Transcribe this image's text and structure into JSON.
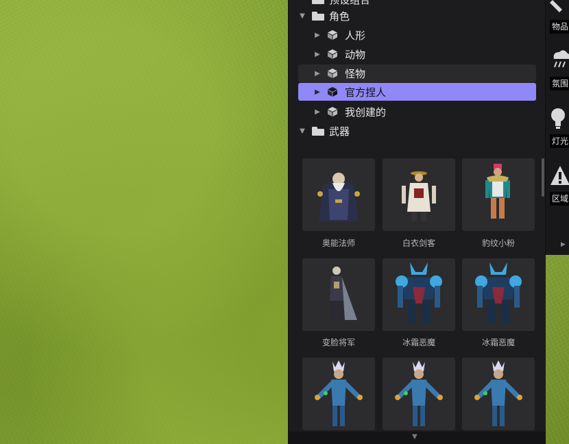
{
  "tree": {
    "top_partial_label": "预设组合",
    "items": [
      {
        "label": "角色",
        "type": "folder",
        "expanded": true,
        "level": 0
      },
      {
        "label": "人形",
        "type": "model",
        "expanded": false,
        "level": 1
      },
      {
        "label": "动物",
        "type": "model",
        "expanded": false,
        "level": 1
      },
      {
        "label": "怪物",
        "type": "model",
        "expanded": false,
        "level": 1,
        "state": "hover"
      },
      {
        "label": "官方捏人",
        "type": "model",
        "expanded": false,
        "level": 1,
        "state": "selected"
      },
      {
        "label": "我创建的",
        "type": "model",
        "expanded": false,
        "level": 1
      },
      {
        "label": "武器",
        "type": "folder",
        "expanded": true,
        "level": 0
      }
    ]
  },
  "grid": {
    "items": [
      {
        "name": "奥能法师",
        "figure": "wizard"
      },
      {
        "name": "白衣剑客",
        "figure": "swordsman"
      },
      {
        "name": "豹纹小粉",
        "figure": "pink"
      },
      {
        "name": "变脸将军",
        "figure": "general"
      },
      {
        "name": "冰霜恶魔",
        "figure": "frost"
      },
      {
        "name": "冰霜恶魔",
        "figure": "frost"
      },
      {
        "name": "",
        "figure": "blue"
      },
      {
        "name": "",
        "figure": "blue"
      },
      {
        "name": "",
        "figure": "blue"
      }
    ]
  },
  "toolbar": {
    "items": [
      {
        "label": "物品",
        "icon": "wrench-icon"
      },
      {
        "label": "氛围",
        "icon": "cloud-rain-icon"
      },
      {
        "label": "灯光",
        "icon": "bulb-icon"
      },
      {
        "label": "区域",
        "icon": "warning-icon"
      }
    ]
  },
  "colors": {
    "panel_bg": "#1c1c1e",
    "selected": "#9088f6",
    "card_bg": "#2c2c2e",
    "toolbar_bg": "#18181a"
  }
}
